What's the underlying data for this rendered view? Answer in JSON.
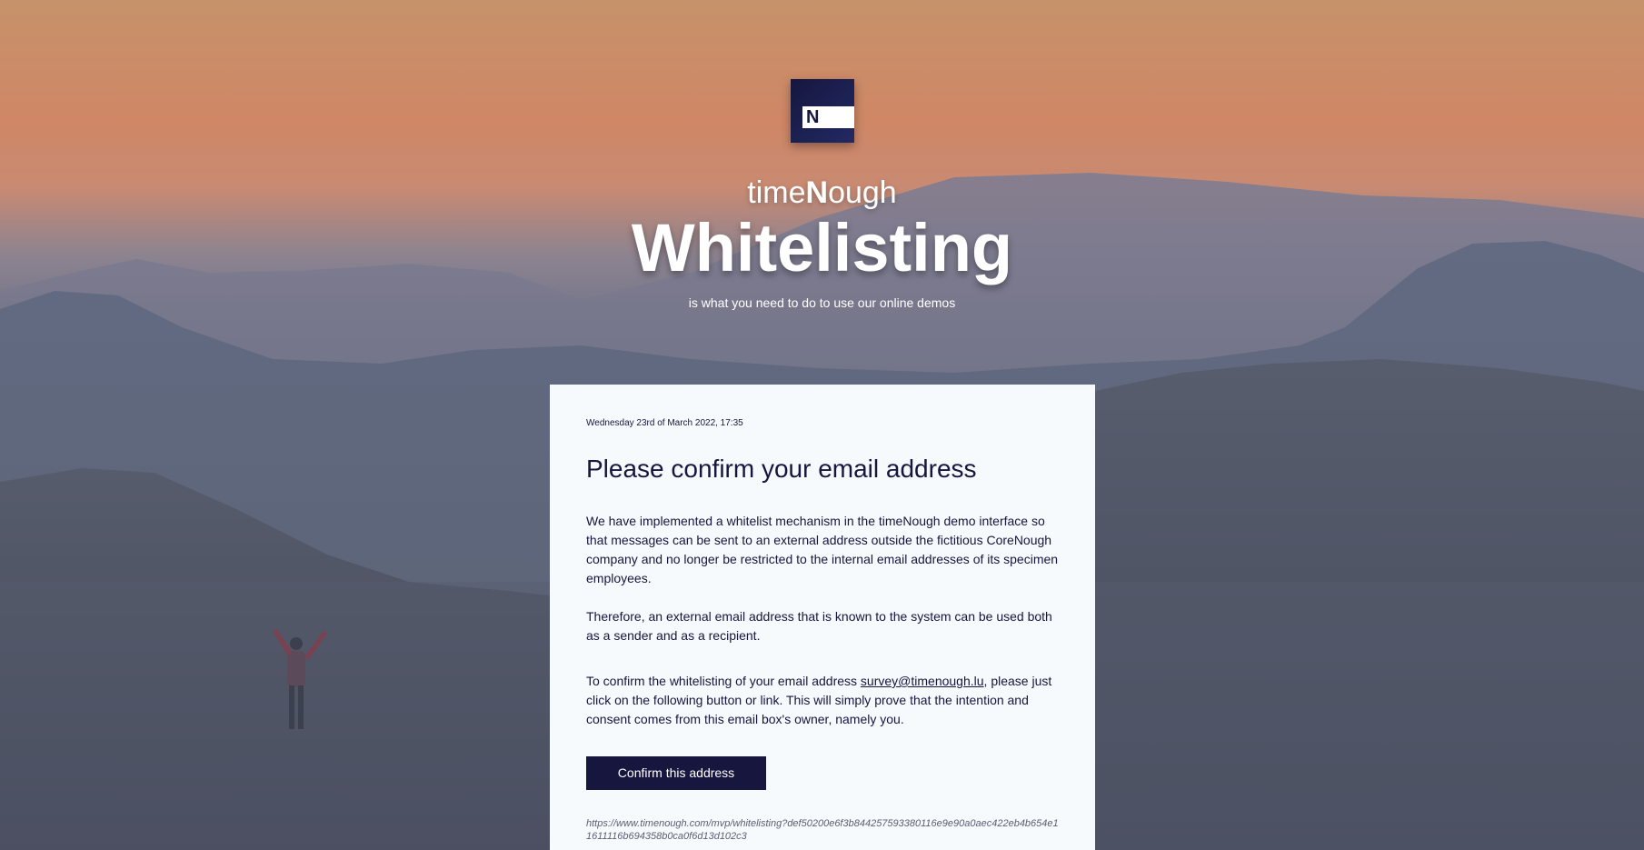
{
  "brand": {
    "name_prefix": "time",
    "name_bold": "N",
    "name_suffix": "ough",
    "logo_letter": "N"
  },
  "hero": {
    "headline": "Whitelisting",
    "tagline": "is what you need to do to use our online demos"
  },
  "email": {
    "date": "Wednesday 23rd of March 2022, 17:35",
    "title": "Please confirm your email address",
    "paragraph1": "We have implemented a whitelist mechanism in the timeNough demo interface so that messages can be sent to an external address outside the fictitious CoreNough company and no longer be restricted to the internal email addresses of its specimen employees.",
    "paragraph2": "Therefore, an external email address that is known to the system can be used both as a sender and as a recipient.",
    "paragraph3_before": "To confirm the whitelisting of your email address ",
    "email_address": "survey@timenough.lu",
    "paragraph3_after": ", please just click on the following button or link. This will simply prove that the intention and consent comes from this email box's owner, namely you.",
    "confirm_button": "Confirm this address",
    "confirm_link": "https://www.timenough.com/mvp/whitelisting?def50200e6f3b844257593380116e9e90a0aec422eb4b654e11611116b694358b0ca0f6d13d102c3"
  },
  "colors": {
    "brand_navy": "#16163f",
    "card_bg": "#f7fafc",
    "sky_orange": "#cf8766"
  }
}
